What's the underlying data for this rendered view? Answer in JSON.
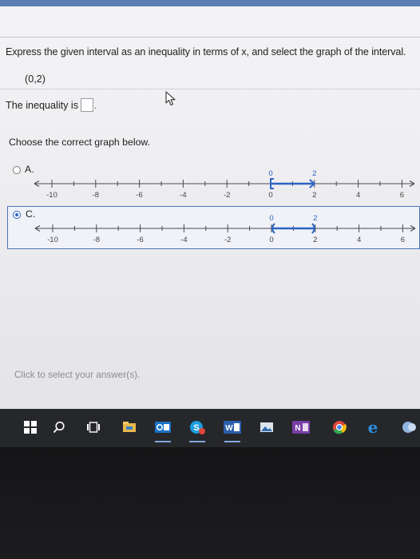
{
  "question": {
    "text": "Express the given interval as an inequality in terms of x, and select the graph of the interval.",
    "interval": "(0,2)"
  },
  "inequality": {
    "label": "The inequality is",
    "value": "",
    "trail": "."
  },
  "choose_prompt": "Choose the correct graph below.",
  "options": [
    {
      "label": "A.",
      "selected": false,
      "endpoint_labels": [
        "0",
        "2"
      ],
      "ticks": [
        "-10",
        "-8",
        "-6",
        "-4",
        "-2",
        "0",
        "2",
        "4",
        "6"
      ]
    },
    {
      "label": "C.",
      "selected": true,
      "endpoint_labels": [
        "0",
        "2"
      ],
      "ticks": [
        "-10",
        "-8",
        "-6",
        "-4",
        "-2",
        "0",
        "2",
        "4",
        "6"
      ]
    }
  ],
  "footer_prompt": "Click to select your answer(s).",
  "taskbar": {
    "icons": [
      "windows-start-icon",
      "search-icon",
      "task-view-icon",
      "file-explorer-icon",
      "outlook-icon",
      "skype-icon",
      "word-icon",
      "photos-icon",
      "onenote-icon",
      "chrome-icon",
      "edge-icon",
      "app-icon"
    ]
  },
  "colors": {
    "accent": "#2d63c4",
    "interval_line": "#2d63c4",
    "top_bar": "#5b7fb3",
    "taskbar": "#26272b"
  }
}
